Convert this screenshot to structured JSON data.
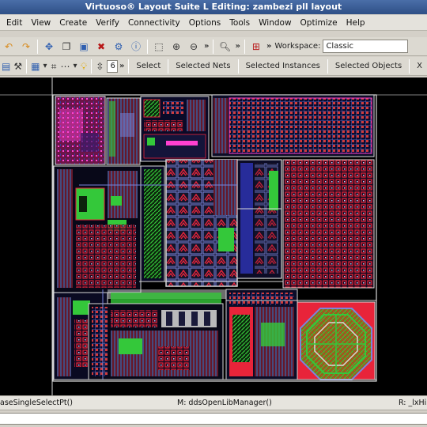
{
  "window": {
    "title": "Virtuoso® Layout Suite L Editing: zambezi pll layout"
  },
  "menubar": {
    "items": [
      "Edit",
      "View",
      "Create",
      "Verify",
      "Connectivity",
      "Options",
      "Tools",
      "Window",
      "Optimize",
      "Help"
    ]
  },
  "toolbar1": {
    "workspace_label": "Workspace:",
    "workspace_value": "Classic"
  },
  "toolbar2": {
    "number_value": "6",
    "chevron": "»",
    "select_label": "Select",
    "selected_nets_label": "Selected Nets",
    "selected_instances_label": "Selected Instances",
    "selected_objects_label": "Selected Objects",
    "close_glyph": "X"
  },
  "status": {
    "left": "aseSingleSelectPt()",
    "middle": "M: ddsOpenLibManager()",
    "right": "R: _lxHiM"
  },
  "colors": {
    "canvas_bg": "#000000",
    "title_bar": "#3a5d96",
    "metal_blue": "#6f7bd8",
    "metal_red": "#e8243a",
    "metal_green": "#34c83a",
    "metal_magenta": "#d83cc8",
    "outline_white": "#d8d8d8"
  },
  "icons": [
    "undo-icon",
    "redo-icon",
    "move-icon",
    "copy-icon",
    "stretch-icon",
    "delete-icon",
    "properties-icon",
    "info-icon",
    "zoom-fit-icon",
    "zoom-in-icon",
    "zoom-out-icon",
    "search-icon",
    "hierarchy-icon",
    "layer-icon",
    "ruler-icon",
    "net-icon",
    "bulb-icon"
  ]
}
